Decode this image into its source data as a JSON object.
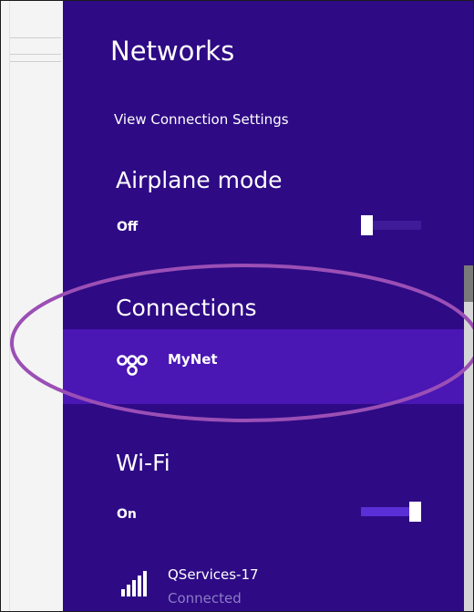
{
  "panel": {
    "title": "Networks",
    "view_settings_link": "View Connection Settings",
    "airplane": {
      "heading": "Airplane mode",
      "state": "Off",
      "enabled": false
    },
    "connections": {
      "heading": "Connections",
      "items": [
        {
          "name": "MyNet",
          "icon": "link-icon"
        }
      ]
    },
    "wifi": {
      "heading": "Wi-Fi",
      "state": "On",
      "enabled": true,
      "networks": [
        {
          "name": "QServices-17",
          "status": "Connected",
          "icon": "signal-bars-icon"
        }
      ]
    }
  },
  "colors": {
    "panel_bg": "#2e0a85",
    "selected_row": "#4a16b4",
    "highlight_ellipse": "#9b4fb5",
    "toggle_off_track": "#3f1a99",
    "toggle_on_track": "#5a2fd6"
  }
}
